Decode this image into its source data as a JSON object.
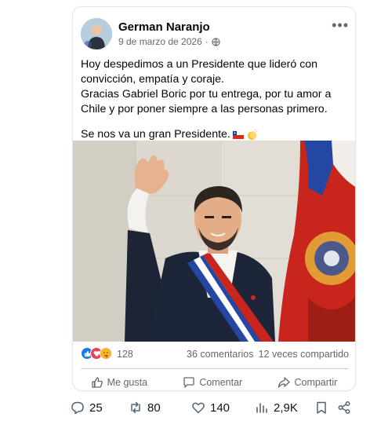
{
  "post": {
    "author": "German Naranjo",
    "date": "9 de marzo de 2026",
    "separator": "·",
    "more": "•••",
    "lines": [
      "Hoy despedimos a un Presidente que lideró con",
      "convicción, empatía y coraje.",
      "Gracias Gabriel Boric por tu entrega, por tu amor a",
      "Chile y por poner siempre a las personas primero."
    ],
    "closing": "Se nos va un gran Presidente."
  },
  "stats": {
    "reactions": "128",
    "comments": "36 comentarios",
    "shares": "12 veces compartido"
  },
  "actions": {
    "like": "Me gusta",
    "comment": "Comentar",
    "share": "Compartir"
  },
  "tweet": {
    "replies": "25",
    "retweets": "80",
    "likes": "140",
    "views": "2,9K"
  },
  "colors": {
    "like_blue": "#1877f2",
    "love_red": "#f33e58",
    "text_gray": "#65676b"
  }
}
